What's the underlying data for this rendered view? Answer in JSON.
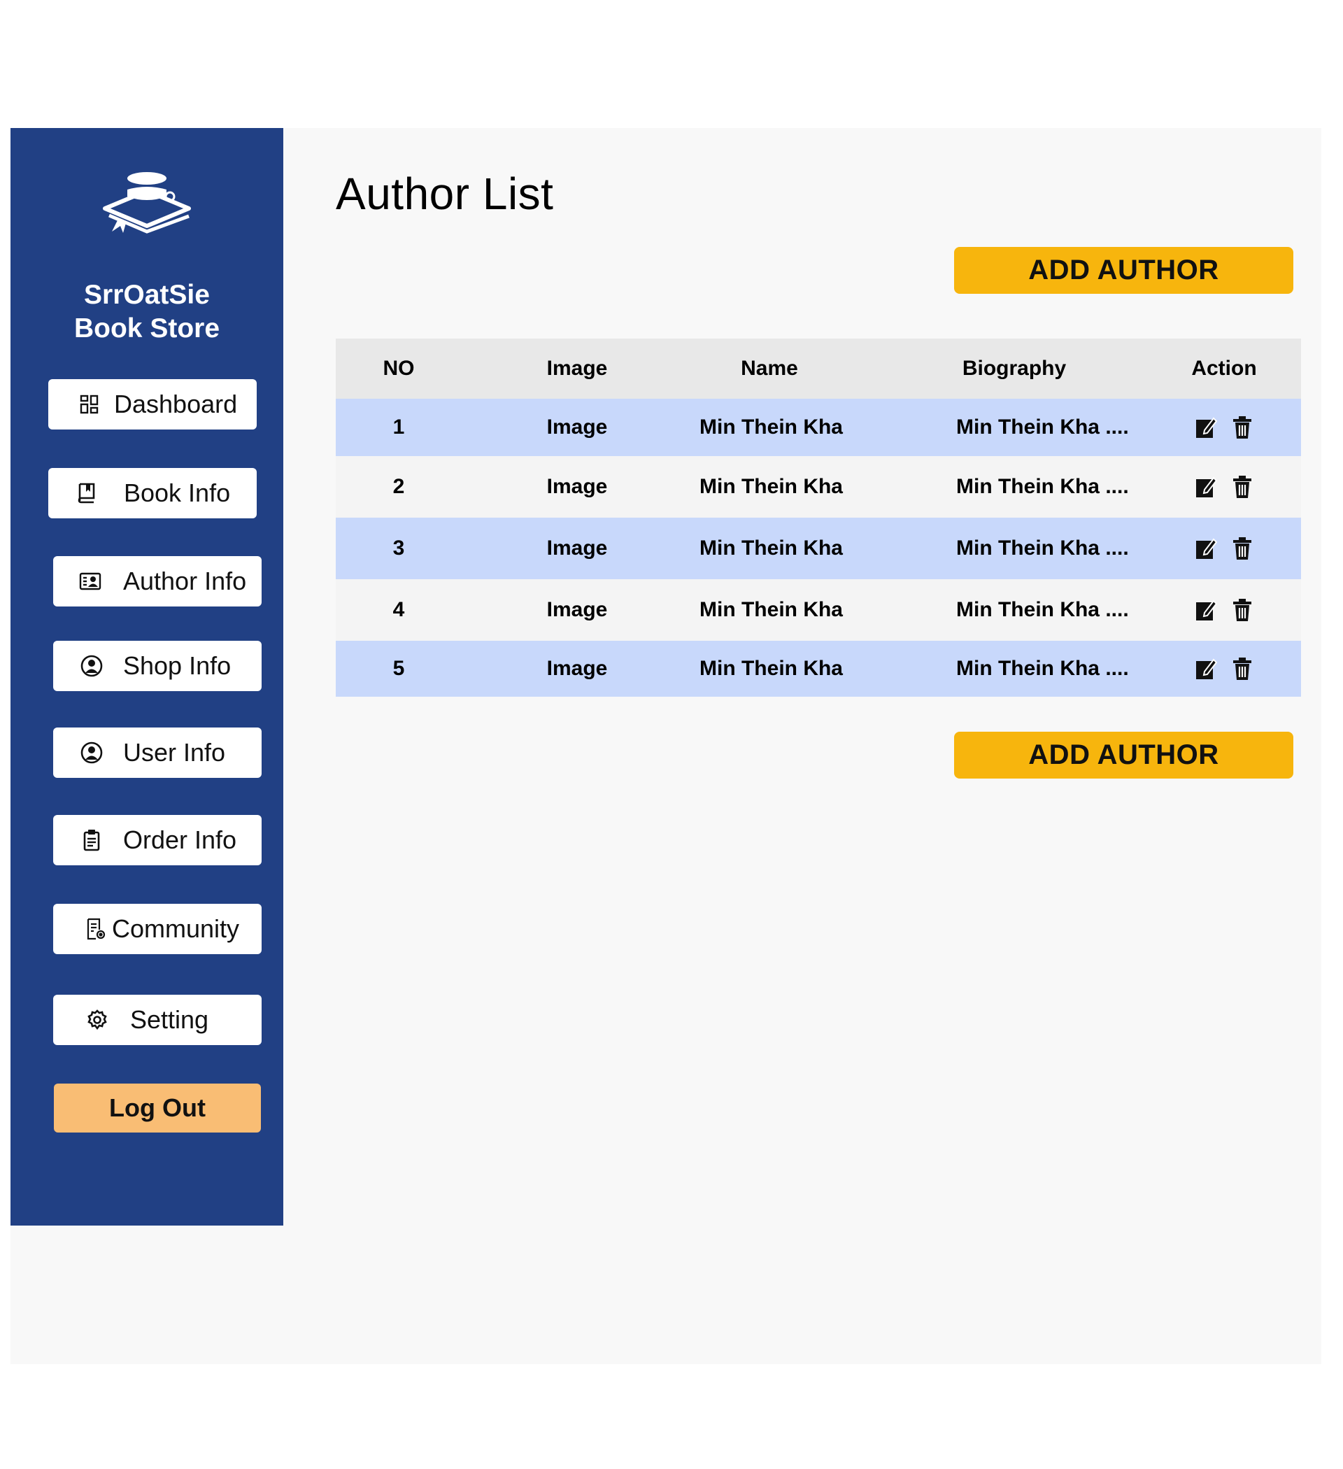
{
  "brand": {
    "line1": "SrrOatSie",
    "line2": "Book Store"
  },
  "sidebar": {
    "items": [
      {
        "label": "Dashboard",
        "icon": "dashboard-icon"
      },
      {
        "label": "Book Info",
        "icon": "book-icon"
      },
      {
        "label": "Author Info",
        "icon": "author-card-icon"
      },
      {
        "label": "Shop Info",
        "icon": "user-circle-icon"
      },
      {
        "label": "User Info",
        "icon": "user-circle-icon"
      },
      {
        "label": "Order Info",
        "icon": "clipboard-icon"
      },
      {
        "label": "Community",
        "icon": "document-settings-icon"
      },
      {
        "label": "Setting",
        "icon": "gear-icon"
      }
    ],
    "logout_label": "Log Out"
  },
  "main": {
    "title": "Author List",
    "add_button_top": "ADD AUTHOR",
    "add_button_bottom": "ADD AUTHOR"
  },
  "table": {
    "headers": {
      "no": "NO",
      "image": "Image",
      "name": "Name",
      "biography": "Biography",
      "action": "Action"
    },
    "rows": [
      {
        "no": "1",
        "image": "Image",
        "name": "Min Thein Kha",
        "biography": "Min Thein Kha ...."
      },
      {
        "no": "2",
        "image": "Image",
        "name": "Min Thein Kha",
        "biography": "Min Thein Kha ...."
      },
      {
        "no": "3",
        "image": "Image",
        "name": "Min Thein Kha",
        "biography": "Min Thein Kha ...."
      },
      {
        "no": "4",
        "image": "Image",
        "name": "Min Thein Kha",
        "biography": "Min Thein Kha ...."
      },
      {
        "no": "5",
        "image": "Image",
        "name": "Min Thein Kha",
        "biography": "Min Thein Kha ...."
      }
    ]
  },
  "colors": {
    "sidebar": "#214084",
    "accent_button": "#f7b50d",
    "logout_button": "#f9bd74",
    "row_highlight": "#c8d8fb",
    "header_row": "#e8e8e8"
  }
}
